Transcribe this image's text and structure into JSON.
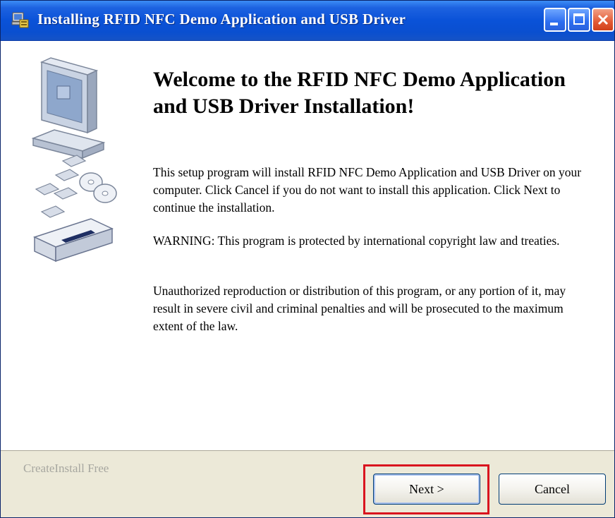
{
  "window": {
    "title": "Installing RFID NFC Demo Application and USB Driver",
    "icon": "installer-icon"
  },
  "content": {
    "heading": "Welcome to the RFID NFC Demo Application and USB Driver Installation!",
    "paragraphs": [
      "This setup program will install RFID NFC Demo Application and USB Driver on your computer. Click Cancel if you do not want to install this application. Click Next to continue the installation.",
      "WARNING: This program is protected by international copyright law and treaties.",
      "Unauthorized reproduction or distribution of this program, or any portion of it, may result in severe civil and criminal penalties and will be prosecuted to the maximum extent of the law."
    ]
  },
  "footer": {
    "brand": "CreateInstall Free",
    "next_label": "Next >",
    "cancel_label": "Cancel"
  },
  "colors": {
    "titlebar": "#0a52d8",
    "footer_bg": "#ece9d8",
    "highlight": "#d9141f"
  }
}
